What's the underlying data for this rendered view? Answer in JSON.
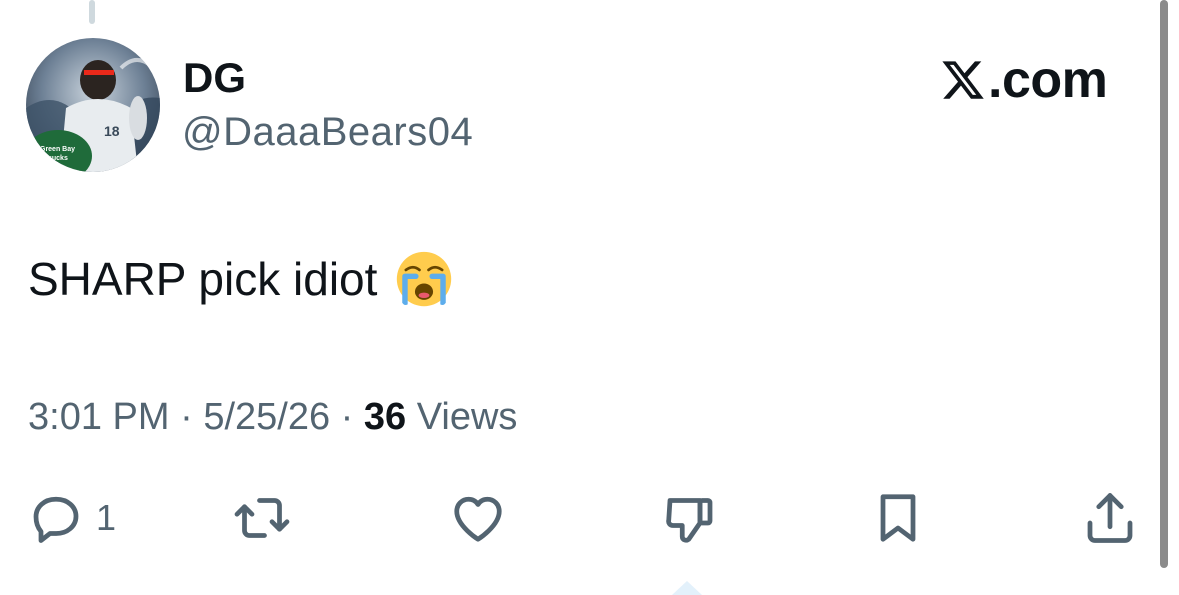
{
  "tweet": {
    "author": {
      "display_name": "DG",
      "handle": "@DaaaBears04"
    },
    "brand": {
      "label": ".com",
      "logo_icon": "x-logo-icon"
    },
    "text": "SHARP pick idiot",
    "emoji": "loudly-crying-face",
    "meta": {
      "time": "3:01 PM",
      "separator": " · ",
      "date": "5/25/26",
      "views_count": "36",
      "views_label": " Views"
    },
    "actions": {
      "reply": {
        "icon": "reply-icon",
        "count": "1"
      },
      "retweet": {
        "icon": "retweet-icon"
      },
      "like": {
        "icon": "heart-icon"
      },
      "dislike": {
        "icon": "thumbs-down-icon"
      },
      "bookmark": {
        "icon": "bookmark-icon"
      },
      "share": {
        "icon": "share-icon"
      }
    },
    "colors": {
      "primary_text": "#0f1419",
      "secondary_text": "#536471"
    }
  }
}
